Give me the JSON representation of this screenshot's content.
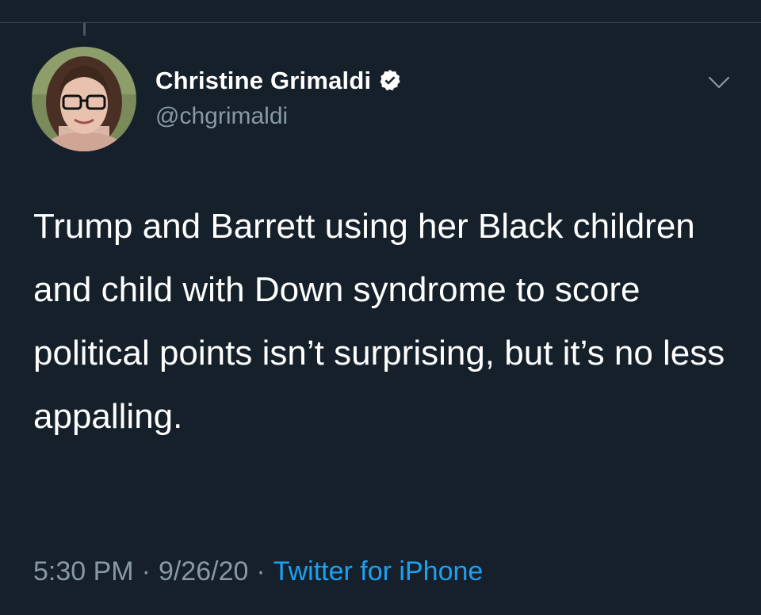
{
  "tweet": {
    "author": {
      "display_name": "Christine Grimaldi",
      "handle": "@chgrimaldi",
      "verified": true,
      "avatar_icon": "profile-photo"
    },
    "text": "Trump and Barrett using her Black children and child with Down syndrome to score political points isn’t surprising, but it’s no less appalling.",
    "time": "5:30 PM",
    "date": "9/26/20",
    "separator": "·",
    "source": "Twitter for iPhone",
    "menu_icon": "chevron-down-icon"
  },
  "colors": {
    "background": "#15202b",
    "text": "#ffffff",
    "secondary_text": "#8899a6",
    "link": "#1da1f2",
    "verified": "#ffffff"
  }
}
